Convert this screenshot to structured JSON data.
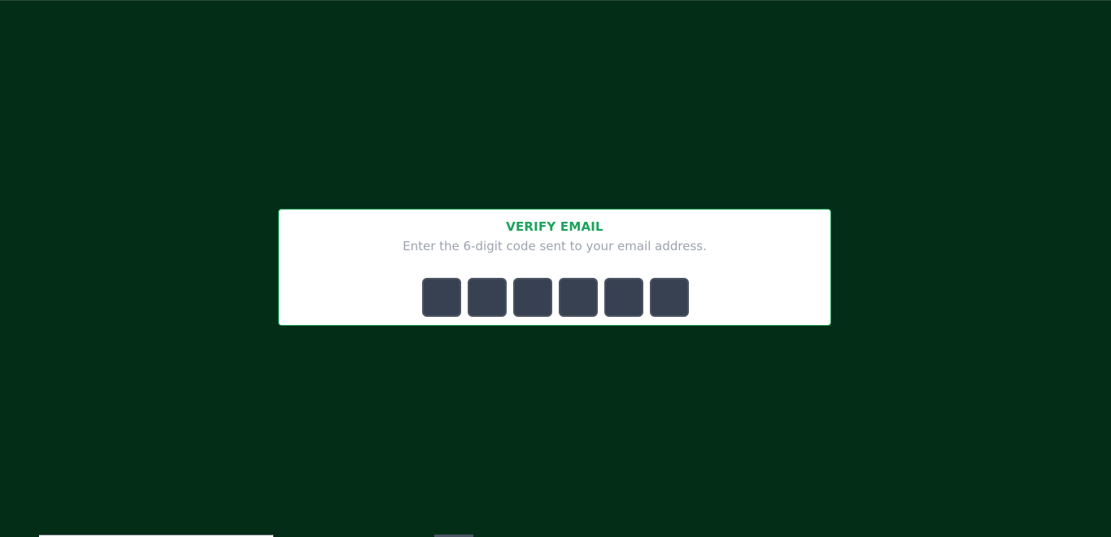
{
  "verify": {
    "title": "VERIFY EMAIL",
    "subtitle": "Enter the 6-digit code sent to your email address.",
    "code_digits": [
      "",
      "",
      "",
      "",
      "",
      ""
    ]
  },
  "colors": {
    "background": "#042d18",
    "accent": "#1aa35c",
    "input_bg": "#374151"
  }
}
